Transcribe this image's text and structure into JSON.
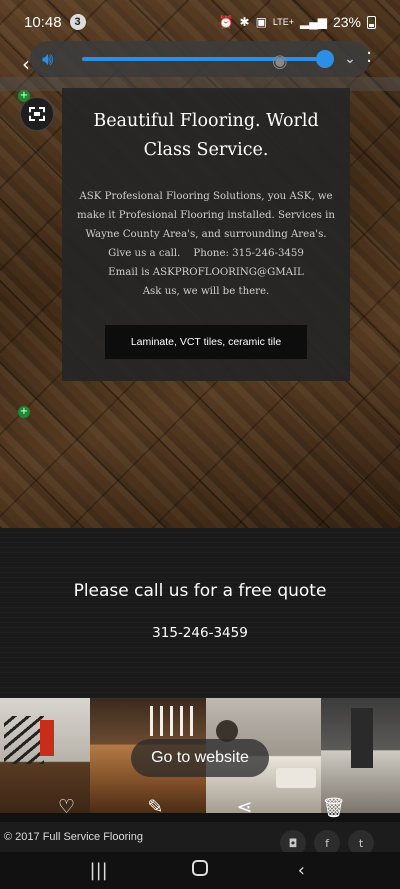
{
  "status_bar": {
    "time": "10:48",
    "notification_count": "3",
    "network": "LTE+",
    "battery": "23%"
  },
  "icons": {
    "volume": "speaker-icon",
    "back": "back-arrow-icon",
    "chevron": "chevron-down-icon",
    "more": "more-vertical-icon",
    "crop": "screenshot-crop-icon",
    "like": "heart-icon",
    "edit": "pencil-icon",
    "share": "share-icon",
    "delete": "trash-icon"
  },
  "colors": {
    "volume_accent": "#2d8ee8",
    "edit_marker": "#1a8c2e"
  },
  "volume": {
    "level": 0.95
  },
  "hero": {
    "title": "Beautiful Flooring. World Class Service.",
    "body_lines": [
      "ASK Profesional Flooring Solutions, you ASK, we",
      "make it Profesional Flooring installed. Services in",
      "Wayne County Area's, and surrounding Area's.",
      "Give us a call.    Phone: 315-246-3459",
      "Email is ASKPROFLOORING@GMAIL",
      "Ask us, we will be there."
    ],
    "button_label": "Laminate, VCT tiles, ceramic tile"
  },
  "cta": {
    "title": "Please call us for a free quote",
    "phone": "315-246-3459"
  },
  "gallery": {
    "overlay_button": "Go to website"
  },
  "footer": {
    "copyright": "© 2017 Full Service Flooring",
    "social": [
      "instagram",
      "facebook",
      "twitter"
    ],
    "social_glyphs": [
      "◘",
      "f",
      "t"
    ]
  }
}
